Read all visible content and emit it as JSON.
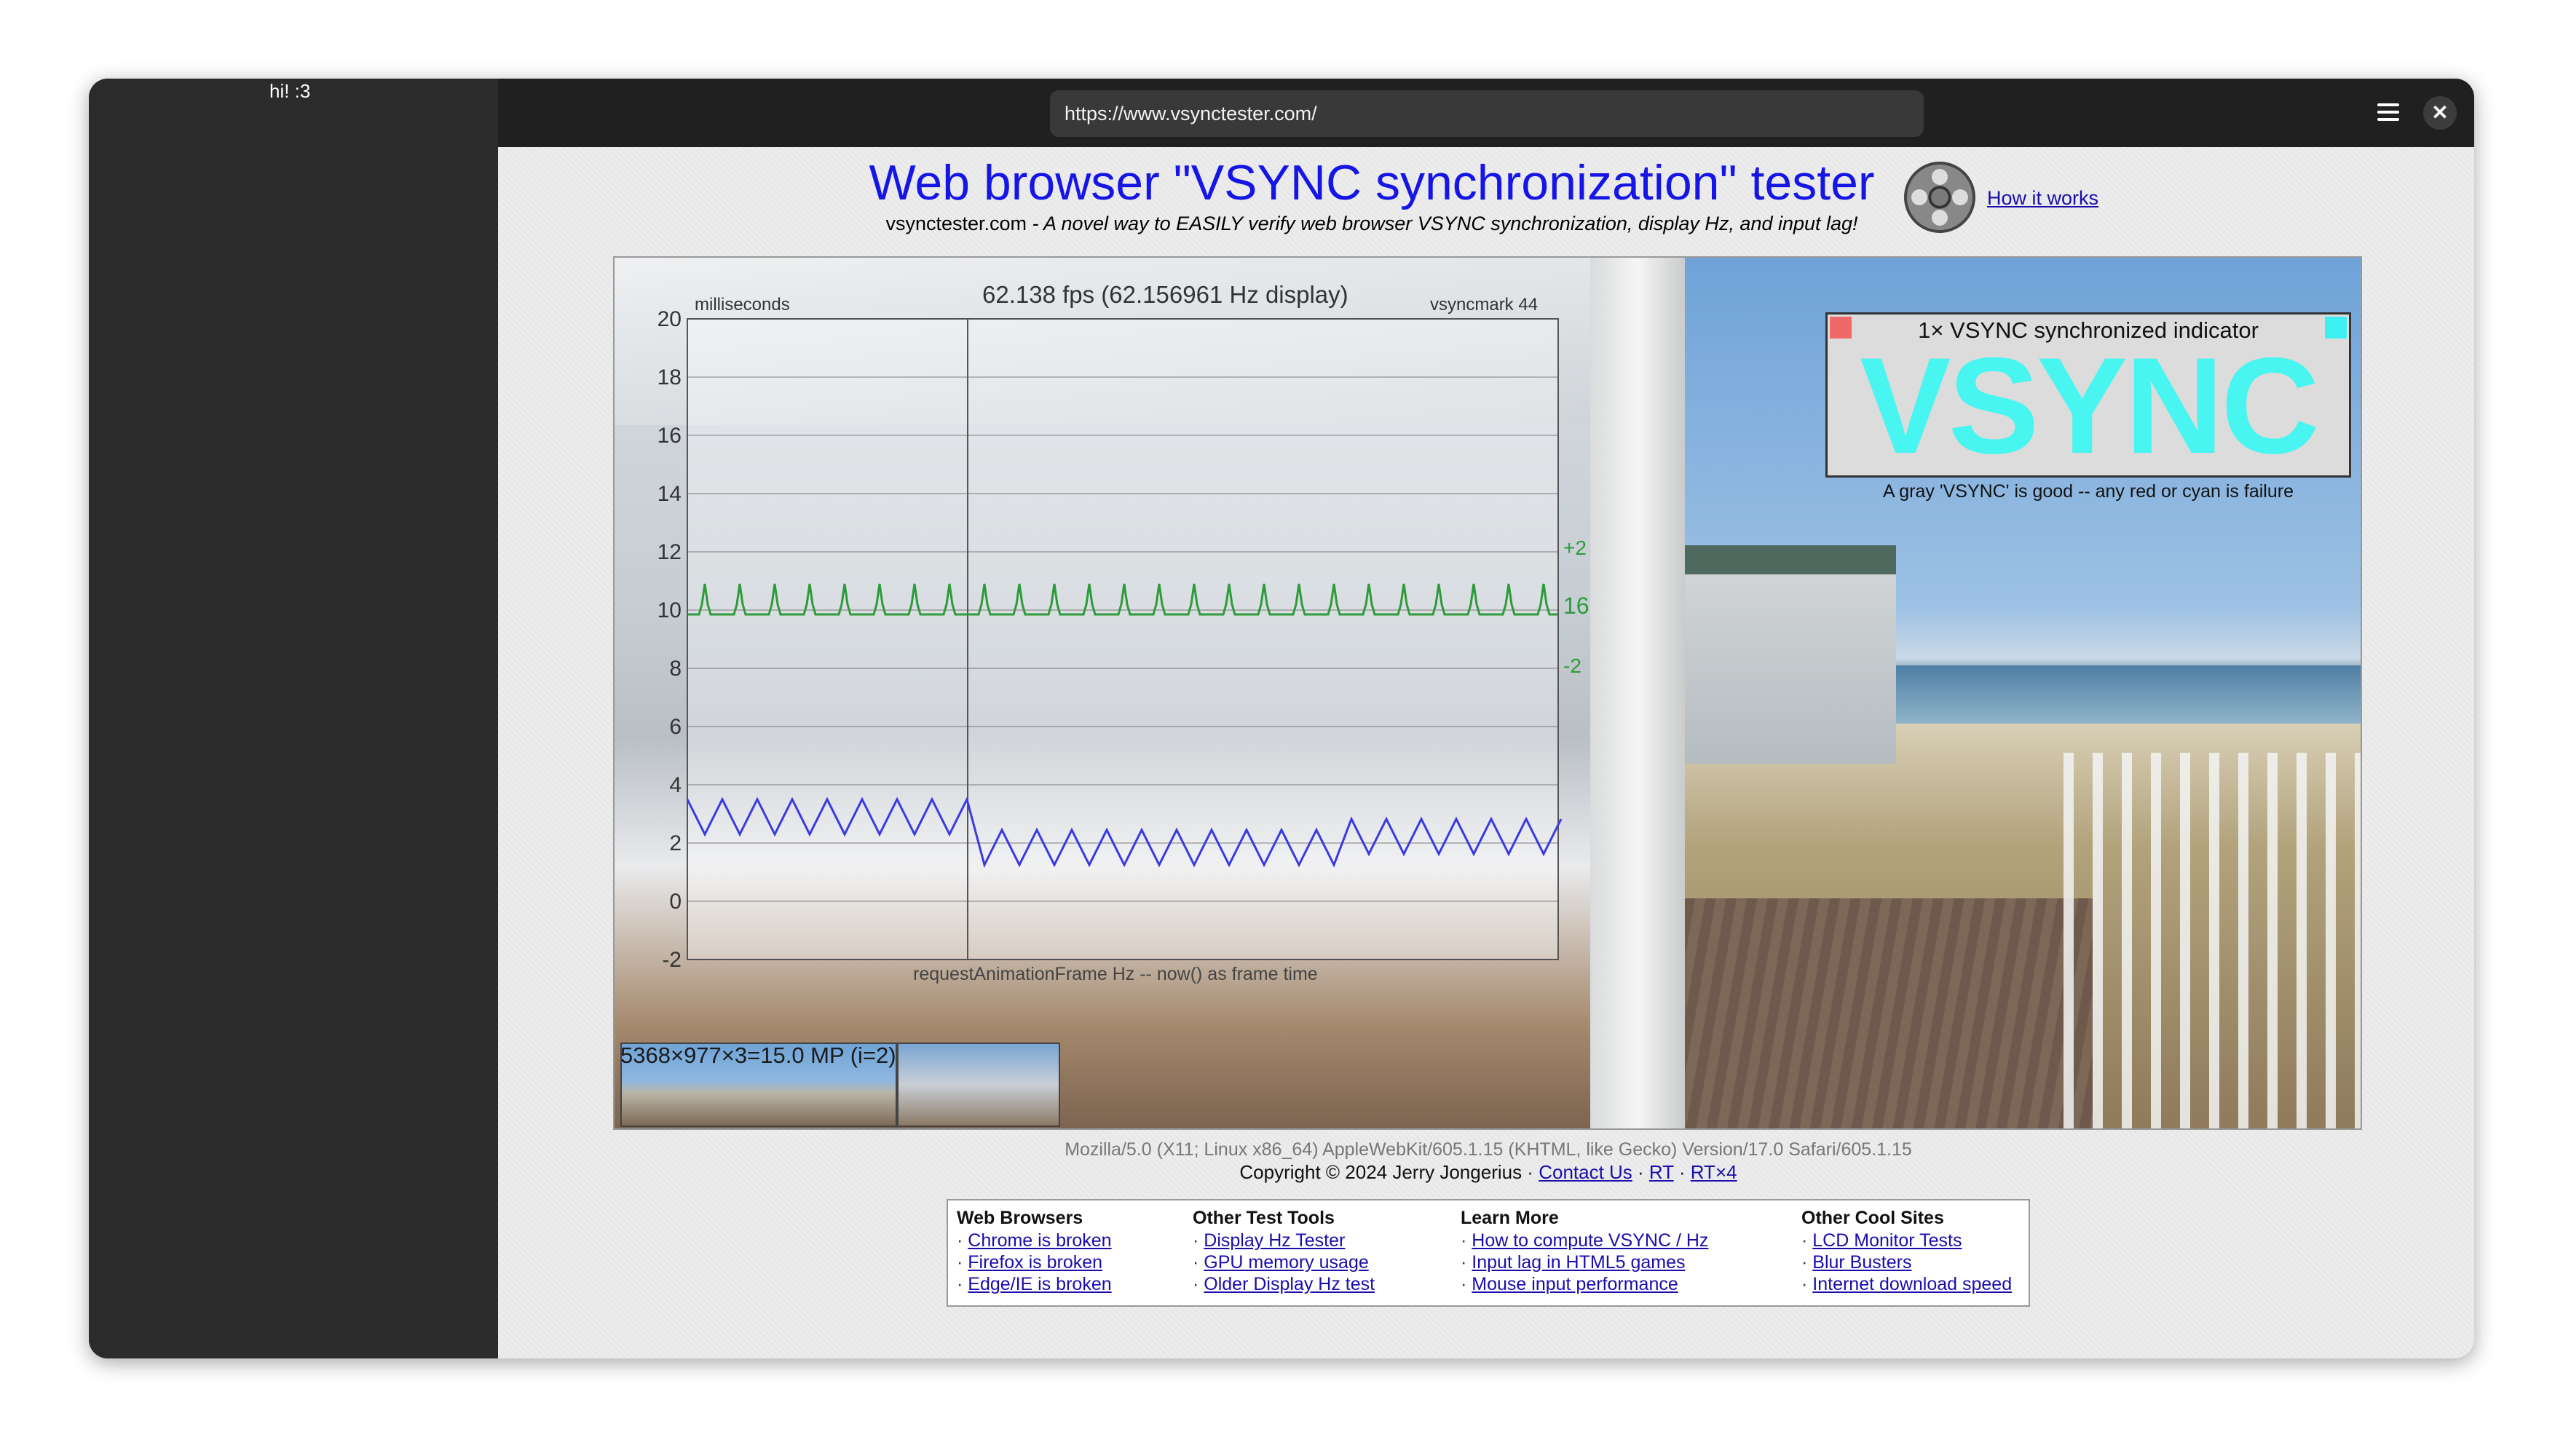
{
  "sidebar": {
    "text": "hi! :3"
  },
  "browser": {
    "url": "https://www.vsynctester.com/",
    "close_label": "✕"
  },
  "page": {
    "title": "Web browser \"VSYNC synchronization\" tester",
    "subtitle_site": "vsynctester.com",
    "subtitle_desc": " - A novel way to EASILY verify web browser VSYNC synchronization, display Hz, and input lag!",
    "how_it_works": "How it works"
  },
  "graph": {
    "fps_text": "62.138 fps  (62.156961 Hz display)",
    "y_unit": "milliseconds",
    "vsyncmark": "vsyncmark 44",
    "y_ticks": [
      "20",
      "18",
      "16",
      "14",
      "12",
      "10",
      "8",
      "6",
      "4",
      "2",
      "0",
      "-2"
    ],
    "side_plus": "+2",
    "side_value": "16.088303",
    "side_minus": "-2",
    "bottom_label": "requestAnimationFrame Hz -- now() as frame time"
  },
  "vsync_indicator": {
    "caption": "1× VSYNC synchronized indicator",
    "big_text": "VSYNC",
    "note": "A gray 'VSYNC' is good -- any red or cyan is failure"
  },
  "thumbs": {
    "label": "5368×977×3=15.0 MP (i=2)"
  },
  "footer": {
    "user_agent": "Mozilla/5.0 (X11; Linux x86_64) AppleWebKit/605.1.15 (KHTML, like Gecko) Version/17.0 Safari/605.1.15",
    "copyright": "Copyright © 2024 Jerry Jongerius · ",
    "contact": "Contact Us",
    "sep1": " · ",
    "rt": "RT",
    "sep2": " · ",
    "rt4": "RT×4"
  },
  "links": {
    "web_browsers": {
      "heading": "Web Browsers",
      "items": [
        "Chrome is broken",
        "Firefox is broken",
        "Edge/IE is broken"
      ]
    },
    "other_tools": {
      "heading": "Other Test Tools",
      "items": [
        "Display Hz Tester",
        "GPU memory usage",
        "Older Display Hz test"
      ]
    },
    "learn_more": {
      "heading": "Learn More",
      "items": [
        "How to compute VSYNC / Hz",
        "Input lag in HTML5 games",
        "Mouse input performance"
      ]
    },
    "cool_sites": {
      "heading": "Other Cool Sites",
      "items": [
        "LCD Monitor Tests",
        "Blur Busters",
        "Internet download speed"
      ]
    }
  },
  "colors": {
    "title": "#1515e6",
    "vsync_cyan": "#48f5f0",
    "green_series": "#2e9b3a",
    "blue_series": "#3a3ae0"
  }
}
